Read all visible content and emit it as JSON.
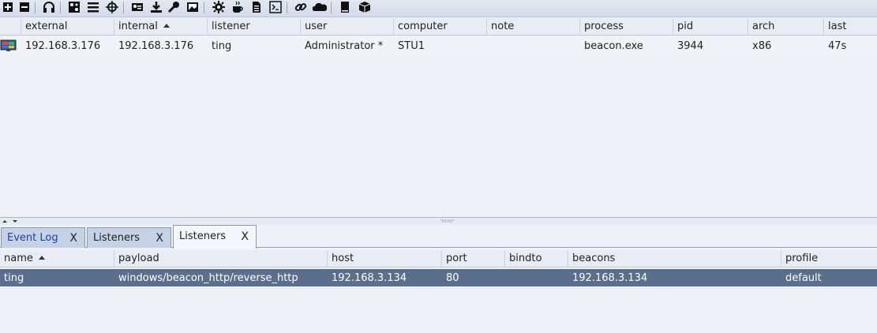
{
  "toolbar": {
    "icons": [
      "new-connection-icon",
      "disconnect-icon",
      "headphones-icon",
      "pivot-graph-icon",
      "session-table-icon",
      "target-crosshair-icon",
      "credentials-icon",
      "downloads-icon",
      "keystrokes-icon",
      "screenshots-icon",
      "settings-gear-icon",
      "coffee-icon",
      "script-document-icon",
      "console-icon",
      "link-icon",
      "cloud-icon",
      "manual-book-icon",
      "package-icon"
    ]
  },
  "beacons": {
    "columns": [
      "external",
      "internal",
      "listener",
      "user",
      "computer",
      "note",
      "process",
      "pid",
      "arch",
      "last"
    ],
    "rows": [
      {
        "external": "192.168.3.176",
        "internal": "192.168.3.176",
        "listener": "ting",
        "user": "Administrator *",
        "computer": "STU1",
        "note": "",
        "process": "beacon.exe",
        "pid": "3944",
        "arch": "x86",
        "last": "47s"
      }
    ]
  },
  "tabs": [
    {
      "label": "Event Log",
      "close": "X"
    },
    {
      "label": "Listeners",
      "close": "X"
    },
    {
      "label": "Listeners",
      "close": "X"
    }
  ],
  "listeners": {
    "columns": [
      "name",
      "payload",
      "host",
      "port",
      "bindto",
      "beacons",
      "profile"
    ],
    "rows": [
      {
        "name": "ting",
        "payload": "windows/beacon_http/reverse_http",
        "host": "192.168.3.134",
        "port": "80",
        "bindto": "",
        "beacons": "192.168.3.134",
        "profile": "default"
      }
    ]
  },
  "colors": {
    "selected_row": "#5a6f8e",
    "event_log_tab_text": "#1a3fb0"
  }
}
